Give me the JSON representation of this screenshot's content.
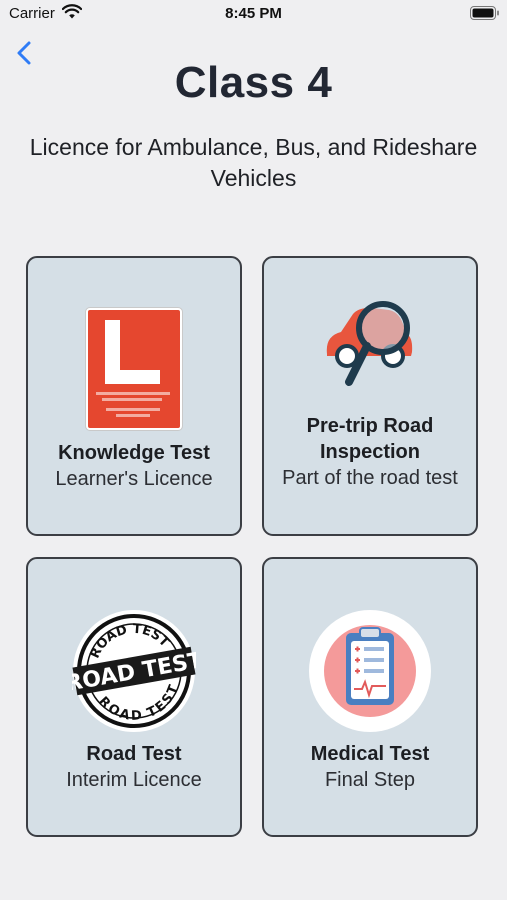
{
  "status_bar": {
    "carrier": "Carrier",
    "time": "8:45 PM"
  },
  "header": {
    "title": "Class 4",
    "subtitle": "Licence for Ambulance, Bus, and Rideshare Vehicles"
  },
  "cards": [
    {
      "title": "Knowledge Test",
      "subtitle": "Learner's Licence",
      "icon": "l-plate-icon"
    },
    {
      "title": "Pre-trip Road Inspection",
      "subtitle": "Part of the road test",
      "icon": "car-magnifier-icon"
    },
    {
      "title": "Road Test",
      "subtitle": "Interim Licence",
      "icon": "road-test-stamp-icon",
      "stamp_text": "ROAD TEST"
    },
    {
      "title": "Medical Test",
      "subtitle": "Final Step",
      "icon": "medical-clipboard-icon"
    }
  ],
  "colors": {
    "accent": "#2f7cf6",
    "card_bg": "#d5dfe6",
    "card_border": "#3b3e44",
    "page_bg": "#efeff1"
  }
}
